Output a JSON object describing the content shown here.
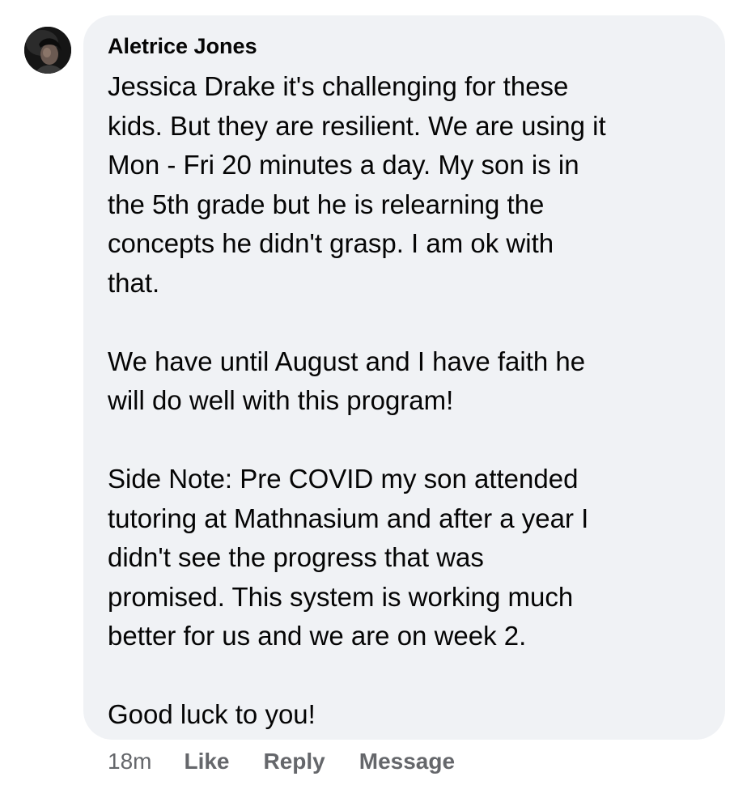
{
  "comment": {
    "author": "Aletrice Jones",
    "paragraphs": [
      {
        "lines": [
          "Jessica Drake it's challenging for these",
          "kids. But they are resilient. We are using it",
          "Mon - Fri 20 minutes a day. My son is in",
          "the 5th grade but he is relearning the",
          "concepts he didn't grasp. I am ok with",
          "that."
        ]
      },
      {
        "lines": [
          "We have until August and I have faith he",
          "will do well with this program!"
        ]
      },
      {
        "lines": [
          "Side Note: Pre COVID my son attended",
          "tutoring at Mathnasium and after a year I",
          "didn't see the progress that was",
          "promised. This system is working much",
          "better for us and we are on week 2."
        ]
      },
      {
        "lines": [
          "Good luck to you!"
        ]
      }
    ],
    "timestamp": "18m",
    "actions": {
      "like": "Like",
      "reply": "Reply",
      "message": "Message"
    }
  },
  "colors": {
    "bubble_background": "#f0f2f5",
    "text_primary": "#050505",
    "text_secondary": "#65676b"
  },
  "icons": {
    "avatar": "profile-photo"
  }
}
